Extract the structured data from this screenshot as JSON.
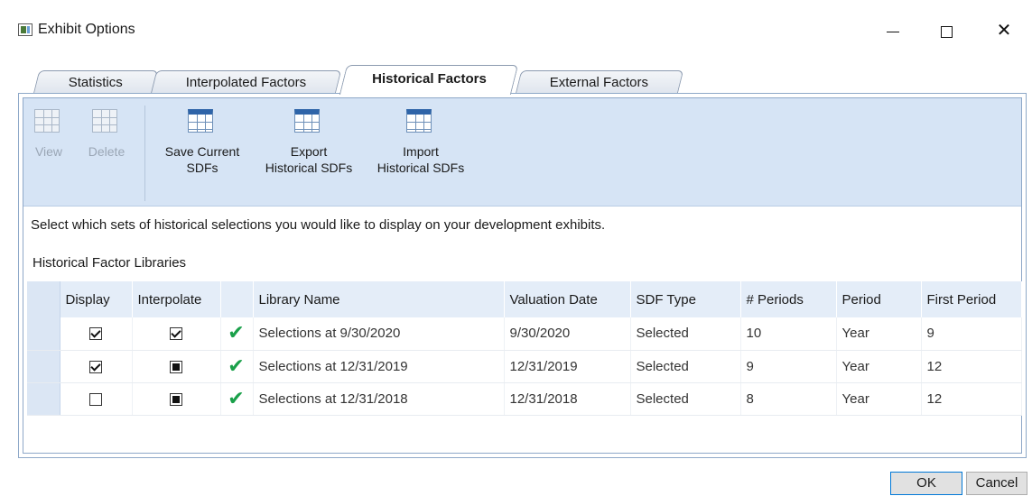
{
  "window": {
    "title": "Exhibit Options",
    "min_glyph": "—",
    "close_glyph": "✕"
  },
  "tabs": [
    {
      "label": "Statistics"
    },
    {
      "label": "Interpolated Factors"
    },
    {
      "label": "Historical Factors"
    },
    {
      "label": "External Factors"
    }
  ],
  "toolbar": {
    "view": "View",
    "delete": "Delete",
    "save_line1": "Save Current",
    "save_line2": "SDFs",
    "export_line1": "Export",
    "export_line2": "Historical SDFs",
    "import_line1": "Import",
    "import_line2": "Historical SDFs"
  },
  "instructions": "Select which sets of historical selections you would like to display on your development exhibits.",
  "libraries_label": "Historical Factor Libraries",
  "columns": [
    "Display",
    "Interpolate",
    "",
    "Library Name",
    "Valuation Date",
    "SDF Type",
    "# Periods",
    "Period",
    "First Period"
  ],
  "rows": [
    {
      "display": true,
      "interpolate": "checked",
      "name": "Selections at 9/30/2020",
      "valuation_date": "9/30/2020",
      "sdf_type": "Selected",
      "periods": "10",
      "period": "Year",
      "first_period": "9"
    },
    {
      "display": true,
      "interpolate": "indeterminate",
      "name": "Selections at 12/31/2019",
      "valuation_date": "12/31/2019",
      "sdf_type": "Selected",
      "periods": "9",
      "period": "Year",
      "first_period": "12"
    },
    {
      "display": false,
      "interpolate": "indeterminate",
      "name": "Selections at 12/31/2018",
      "valuation_date": "12/31/2018",
      "sdf_type": "Selected",
      "periods": "8",
      "period": "Year",
      "first_period": "12"
    }
  ],
  "status_glyph": "✔",
  "buttons": {
    "ok": "OK",
    "cancel": "Cancel"
  },
  "colors": {
    "toolbar_bg": "#d6e4f5",
    "header_bg": "#e4edf8",
    "ok_green": "#1aa04a",
    "accent_blue": "#2e64a8"
  }
}
